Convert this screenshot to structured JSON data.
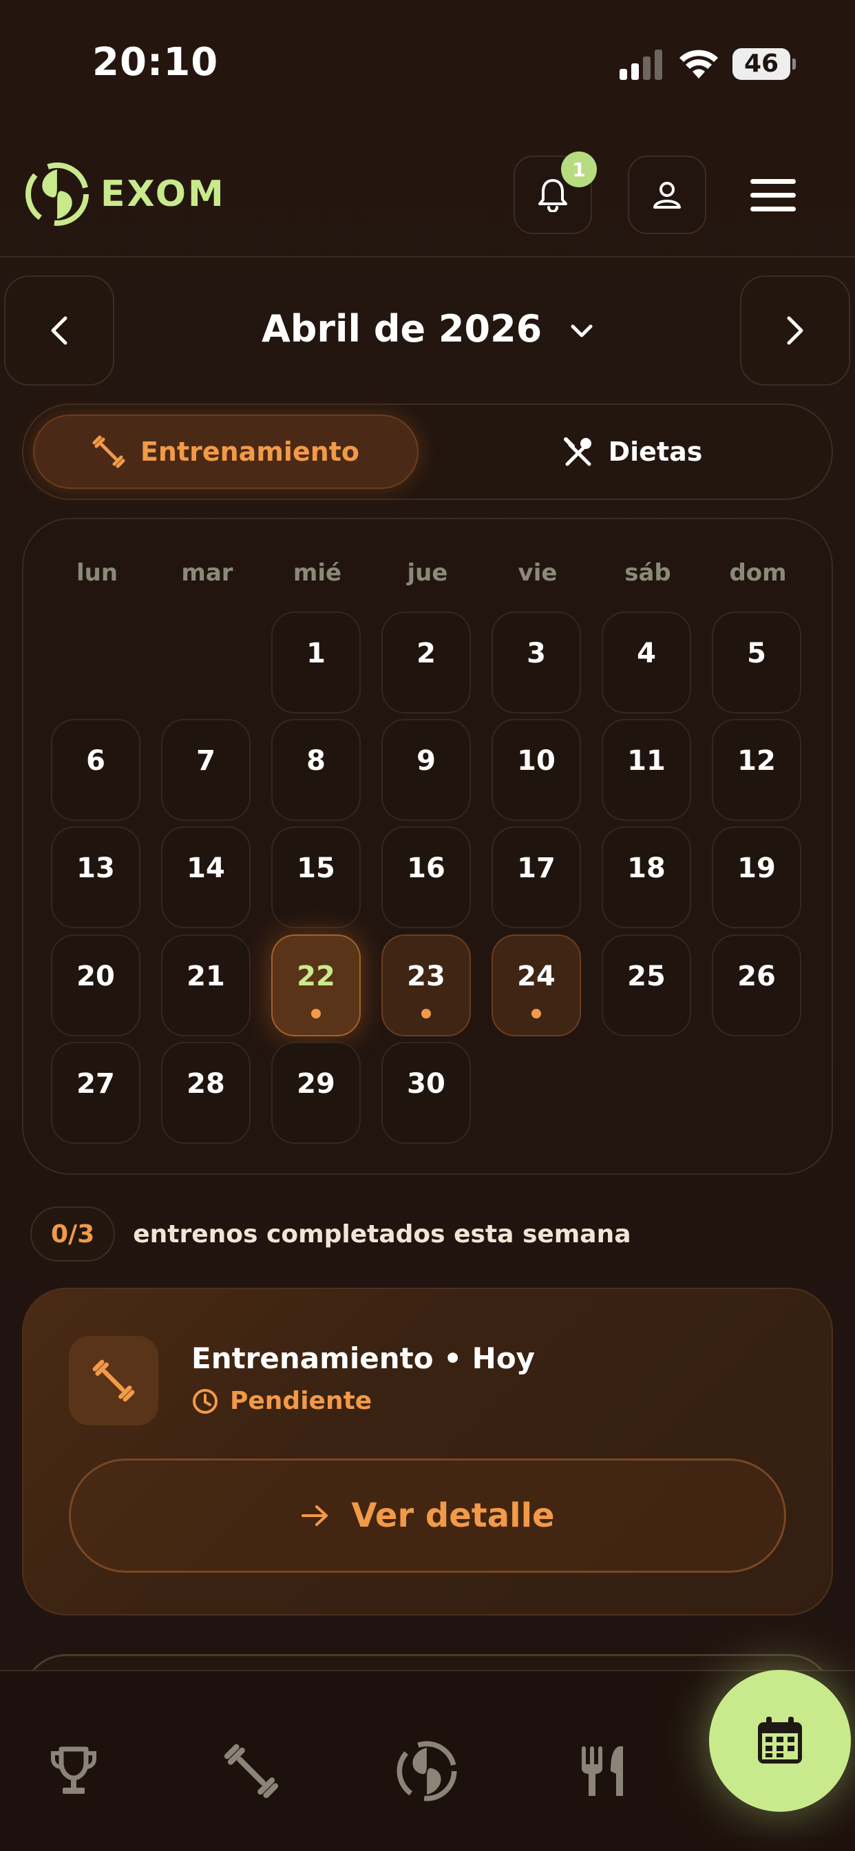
{
  "status_bar": {
    "time": "20:10",
    "battery": "46"
  },
  "header": {
    "brand": "EXOM",
    "notification_count": "1"
  },
  "month_nav": {
    "title": "Abril de 2026"
  },
  "segment": {
    "training_label": "Entrenamiento",
    "diet_label": "Dietas",
    "active": "Entrenamiento"
  },
  "calendar": {
    "weekdays": [
      "lun",
      "mar",
      "mié",
      "jue",
      "vie",
      "sáb",
      "dom"
    ],
    "days": [
      "1",
      "2",
      "3",
      "4",
      "5",
      "6",
      "7",
      "8",
      "9",
      "10",
      "11",
      "12",
      "13",
      "14",
      "15",
      "16",
      "17",
      "18",
      "19",
      "20",
      "21",
      "22",
      "23",
      "24",
      "25",
      "26",
      "27",
      "28",
      "29",
      "30"
    ],
    "first_weekday_index": 2,
    "today": 22,
    "planned_days": [
      22,
      23,
      24
    ]
  },
  "progress": {
    "count": "0/3",
    "label": "entrenos completados esta semana"
  },
  "workout_card": {
    "title": "Entrenamiento • Hoy",
    "status": "Pendiente",
    "button_label": "Ver detalle"
  },
  "bottom_nav": {
    "items": [
      "trophy-icon",
      "dumbbell-icon",
      "exom-logo-icon",
      "fork-knife-icon"
    ],
    "active": "calendar-icon"
  },
  "colors": {
    "accent": "#f29a48",
    "brand_green": "#c9ea8c",
    "background": "#221510"
  }
}
